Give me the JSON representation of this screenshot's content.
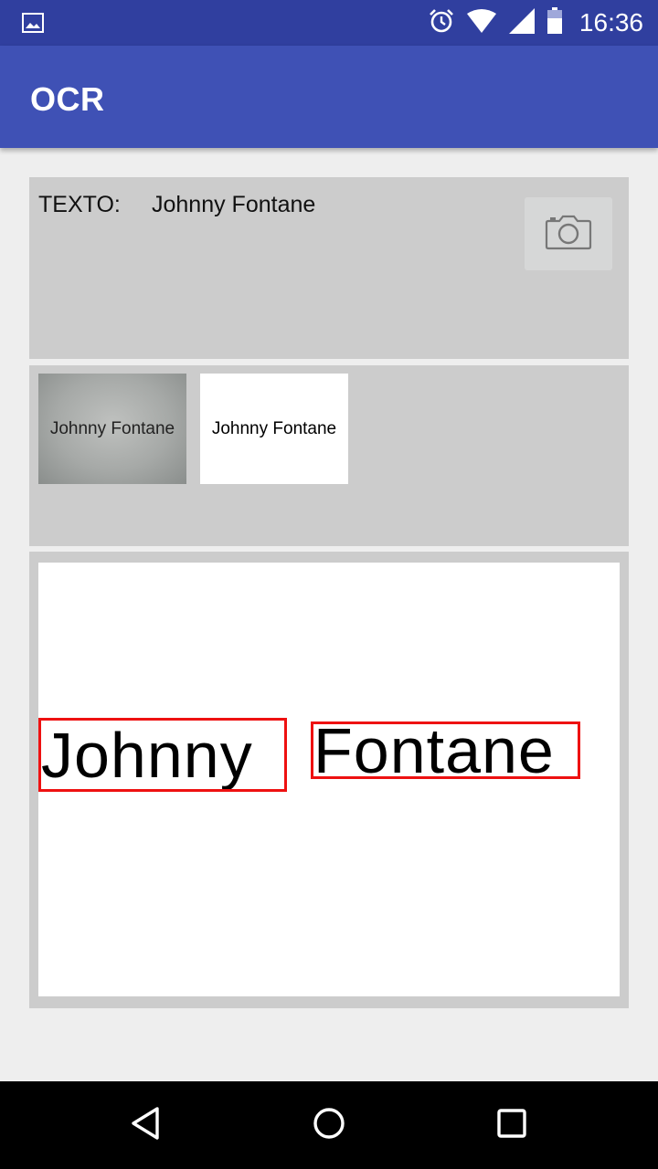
{
  "status_bar": {
    "time": "16:36",
    "icons": [
      "image-notification-icon",
      "alarm-icon",
      "wifi-icon",
      "signal-icon",
      "battery-icon"
    ]
  },
  "app_bar": {
    "title": "OCR"
  },
  "result_panel": {
    "label": "TEXTO:",
    "value": "Johnny Fontane",
    "camera_icon": "camera-icon"
  },
  "thumbnails": [
    {
      "text": "Johnny Fontane",
      "style": "grayscale-photo"
    },
    {
      "text": "Johnny Fontane",
      "style": "binarized"
    }
  ],
  "detection": {
    "words": [
      "Johnny",
      "Fontane"
    ],
    "box_color": "#ee1111"
  },
  "nav_bar": {
    "icons": [
      "back-icon",
      "home-icon",
      "recents-icon"
    ]
  },
  "colors": {
    "status_bar": "#303f9f",
    "app_bar": "#3f51b5",
    "panel": "#cccccc",
    "background": "#eeeeee"
  }
}
